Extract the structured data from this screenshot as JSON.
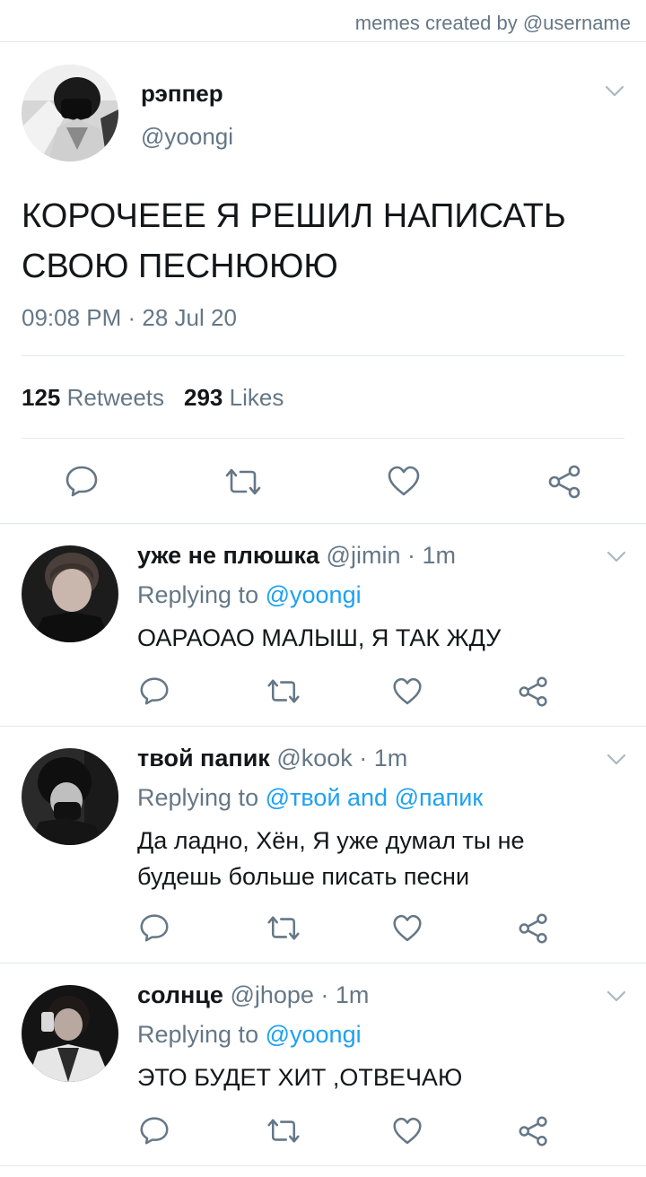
{
  "credit": "memes created by @username",
  "colors": {
    "link": "#1da1f2",
    "muted": "#657786",
    "text": "#14171a",
    "divider": "#e1e8ed"
  },
  "icons": {
    "reply": "reply-icon",
    "retweet": "retweet-icon",
    "like": "heart-icon",
    "share": "share-icon",
    "menu": "chevron-down-icon"
  },
  "main_tweet": {
    "name": "рэппер",
    "handle": "@yoongi",
    "text_lines": [
      "КОРОЧЕЕЕ Я РЕШИЛ НАПИСАТЬ",
      "СВОЮ ПЕСНЮЮЮ"
    ],
    "time": "09:08 PM · 28 Jul 20",
    "retweets_count": "125",
    "retweets_label": "Retweets",
    "likes_count": "293",
    "likes_label": "Likes"
  },
  "replies": [
    {
      "name": "уже не плюшка",
      "meta": "@jimin · 1m",
      "replying_prefix": "Replying to",
      "replying_handles": "@yoongi",
      "text_lines": [
        "ОАРАОАО МАЛЫШ, Я ТАК ЖДУ"
      ]
    },
    {
      "name": "твой папик",
      "meta": "@kook · 1m",
      "replying_prefix": "Replying to",
      "replying_handles": "@твой and @папик",
      "text_lines": [
        "Да ладно, Хён,  Я уже думал ты не",
        "будешь больше писать песни"
      ]
    },
    {
      "name": "солнце",
      "meta": "@jhope · 1m",
      "replying_prefix": "Replying to",
      "replying_handles": "@yoongi",
      "text_lines": [
        "ЭТО БУДЕТ ХИТ ,ОТВЕЧАЮ"
      ]
    }
  ]
}
